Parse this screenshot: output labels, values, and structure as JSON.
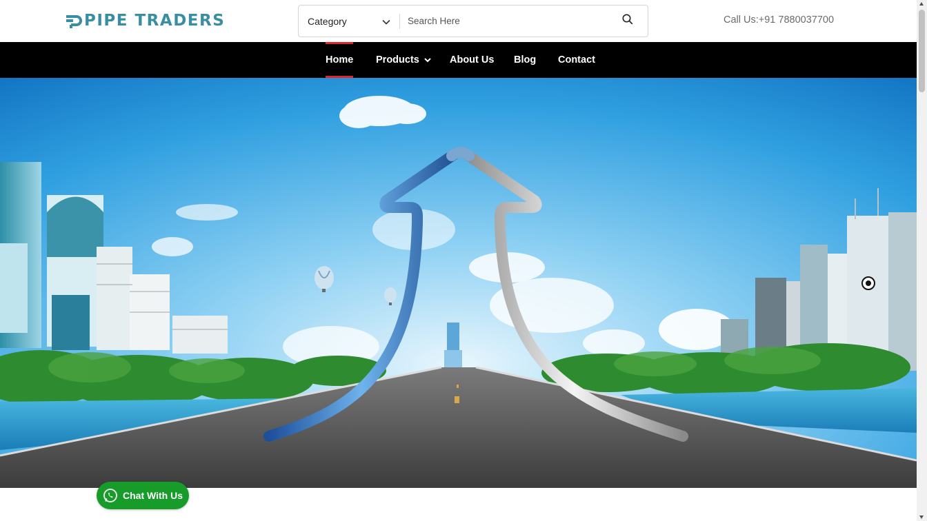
{
  "brand": {
    "name": "PIPE TRADERS",
    "color": "#3a8ea3"
  },
  "search": {
    "category_label": "Category",
    "placeholder": "Search Here"
  },
  "contact": {
    "call_text": "Call Us:+91 7880037700"
  },
  "nav": {
    "items": [
      {
        "label": "Home",
        "active": true
      },
      {
        "label": "Products",
        "has_dropdown": true
      },
      {
        "label": "About Us"
      },
      {
        "label": "Blog"
      },
      {
        "label": "Contact"
      }
    ],
    "accent": "#e0242b"
  },
  "hero": {
    "image": "city skyline with two pipes forming an upward arrow over a road",
    "slider_indicator": "radio-dot-icon"
  },
  "chat": {
    "label": "Chat With Us",
    "color": "#179c2a",
    "icon": "whatsapp-icon"
  }
}
